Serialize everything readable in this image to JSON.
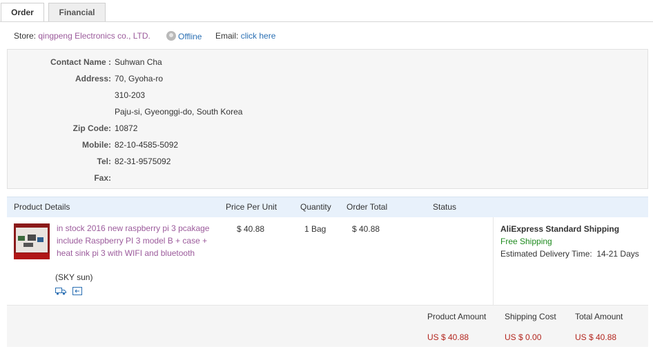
{
  "tabs": [
    {
      "label": "Order",
      "active": true
    },
    {
      "label": "Financial",
      "active": false
    }
  ],
  "store": {
    "label": "Store:",
    "name": "qingpeng Electronics co., LTD.",
    "status": "Offline",
    "email_label": "Email:",
    "email_link": "click here"
  },
  "address": {
    "rows": [
      {
        "key": "Contact Name :",
        "value": "Suhwan Cha"
      },
      {
        "key": "Address:",
        "value": "70, Gyoha-ro"
      },
      {
        "key": "",
        "value": "310-203"
      },
      {
        "key": "",
        "value": "Paju-si, Gyeonggi-do, South Korea"
      },
      {
        "key": "Zip Code:",
        "value": "10872"
      },
      {
        "key": "Mobile:",
        "value": "82-10-4585-5092"
      },
      {
        "key": "Tel:",
        "value": "82-31-9575092"
      },
      {
        "key": "Fax:",
        "value": ""
      }
    ]
  },
  "table": {
    "headers": {
      "product": "Product Details",
      "price": "Price Per Unit",
      "quantity": "Quantity",
      "total": "Order Total",
      "status": "Status"
    },
    "item": {
      "title": "in stock 2016 new raspberry pi 3 pcakage include Raspberry PI 3 model B + case + heat sink pi 3 with WIFI and bluetooth",
      "seller": "(SKY sun)",
      "price": "$ 40.88",
      "quantity": "1 Bag",
      "total": "$ 40.88",
      "status": "",
      "shipping_method": "AliExpress Standard Shipping",
      "shipping_cost_note": "Free Shipping",
      "delivery_label": "Estimated Delivery Time:",
      "delivery_value": "14-21 Days"
    }
  },
  "summary": {
    "product_amount_label": "Product Amount",
    "shipping_cost_label": "Shipping Cost",
    "total_amount_label": "Total Amount",
    "product_amount": "US $ 40.88",
    "shipping_cost": "US $ 0.00",
    "total_amount": "US $ 40.88"
  },
  "colors": {
    "link_purple": "#9b5a9b",
    "link_blue": "#2a6fb3",
    "header_bg": "#e8f1fb",
    "price_red": "#b3261e",
    "free_green": "#1e8a1e"
  },
  "icons": [
    "offline-status-icon",
    "shipping-truck-icon",
    "return-icon"
  ]
}
